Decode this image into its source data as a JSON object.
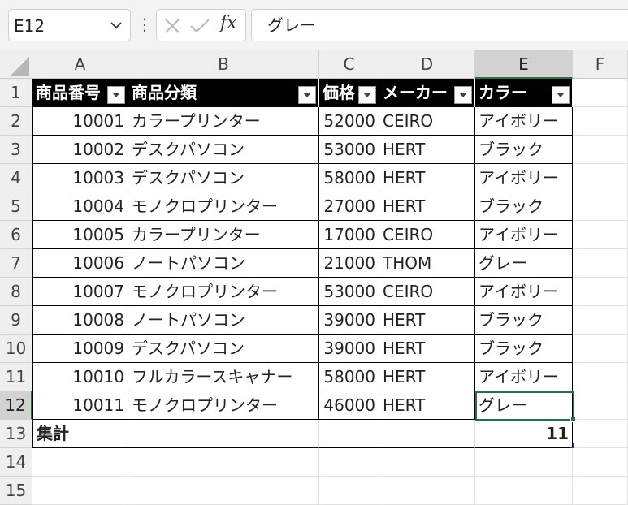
{
  "formula_bar": {
    "name_box": "E12",
    "formula": "グレー",
    "fx_label": "fx"
  },
  "columns": [
    "A",
    "B",
    "C",
    "D",
    "E",
    "F"
  ],
  "selected_column": "E",
  "row_numbers": [
    "1",
    "2",
    "3",
    "4",
    "5",
    "6",
    "7",
    "8",
    "9",
    "10",
    "11",
    "12",
    "13",
    "14",
    "15"
  ],
  "selected_row": "12",
  "table": {
    "headers": [
      "商品番号",
      "商品分類",
      "価格",
      "メーカー",
      "カラー"
    ],
    "rows": [
      [
        "10001",
        "カラープリンター",
        "52000",
        "CEIRO",
        "アイボリー"
      ],
      [
        "10002",
        "デスクパソコン",
        "53000",
        "HERT",
        "ブラック"
      ],
      [
        "10003",
        "デスクパソコン",
        "58000",
        "HERT",
        "アイボリー"
      ],
      [
        "10004",
        "モノクロプリンター",
        "27000",
        "HERT",
        "ブラック"
      ],
      [
        "10005",
        "カラープリンター",
        "17000",
        "CEIRO",
        "アイボリー"
      ],
      [
        "10006",
        "ノートパソコン",
        "21000",
        "THOM",
        "グレー"
      ],
      [
        "10007",
        "モノクロプリンター",
        "53000",
        "CEIRO",
        "アイボリー"
      ],
      [
        "10008",
        "ノートパソコン",
        "39000",
        "HERT",
        "ブラック"
      ],
      [
        "10009",
        "デスクパソコン",
        "39000",
        "HERT",
        "ブラック"
      ],
      [
        "10010",
        "フルカラースキャナー",
        "58000",
        "HERT",
        "アイボリー"
      ],
      [
        "10011",
        "モノクロプリンター",
        "46000",
        "HERT",
        "グレー"
      ]
    ],
    "total_label": "集計",
    "total_value": "11"
  },
  "colors": {
    "accent": "#217346",
    "header_bg": "#000000",
    "header_text": "#ffffff"
  }
}
